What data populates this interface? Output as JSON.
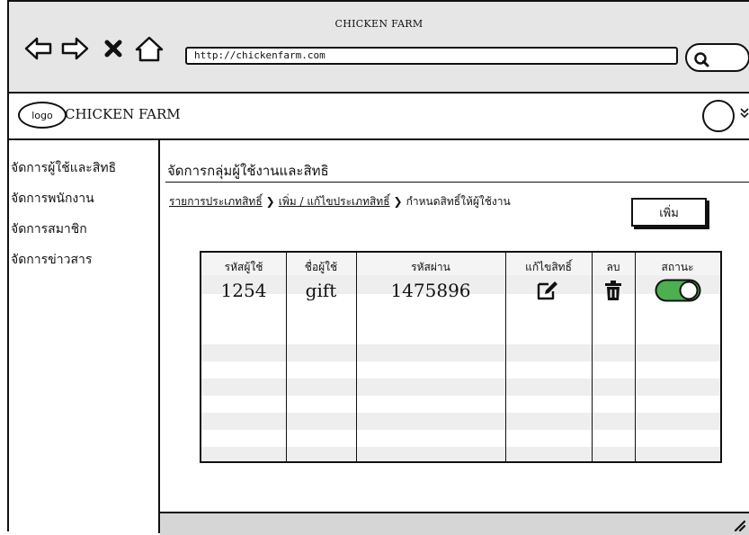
{
  "window": {
    "title": "CHICKEN FARM"
  },
  "browser": {
    "url": "http://chickenfarm.com",
    "nav_icons": [
      "back-arrow-icon",
      "forward-arrow-icon",
      "close-x-icon",
      "home-icon"
    ],
    "search_icon": "search-icon"
  },
  "header": {
    "logo_label": "logo",
    "brand": "CHICKEN FARM",
    "avatar_icon": "user-avatar",
    "menu_icon": "chevron-double-down-icon"
  },
  "sidebar": {
    "items": [
      {
        "label": "จัดการผู้ใช้และสิทธิ"
      },
      {
        "label": "จัดการพนักงาน"
      },
      {
        "label": "จัดการสมาชิก"
      },
      {
        "label": "จัดการข่าวสาร"
      }
    ]
  },
  "main": {
    "title": "จัดการกลุ่มผู้ใช้งานและสิทธิ",
    "breadcrumb": [
      {
        "label": "รายการประเภทสิทธิ์"
      },
      {
        "label": "เพิ่ม / แก้ไขประเภทสิทธิ์"
      },
      {
        "label": "กำหนดสิทธิ์ให้ผู้ใช้งาน"
      }
    ],
    "add_button": "เพิ่ม",
    "table": {
      "columns": [
        "รหัสผู้ใช้",
        "ชื่อผู้ใช้",
        "รหัสผ่าน",
        "แก้ไขสิทธิ์",
        "ลบ",
        "สถานะ"
      ],
      "rows": [
        {
          "user_id": "1254",
          "username": "gift",
          "password": "1475896",
          "edit_icon": "edit-icon",
          "delete_icon": "trash-icon",
          "status_on": true
        }
      ]
    }
  },
  "colors": {
    "chrome": "#e6e6e6",
    "toggle_on": "#4caf50",
    "stripe": "#eeeeee",
    "footer": "#d6d6d6"
  }
}
